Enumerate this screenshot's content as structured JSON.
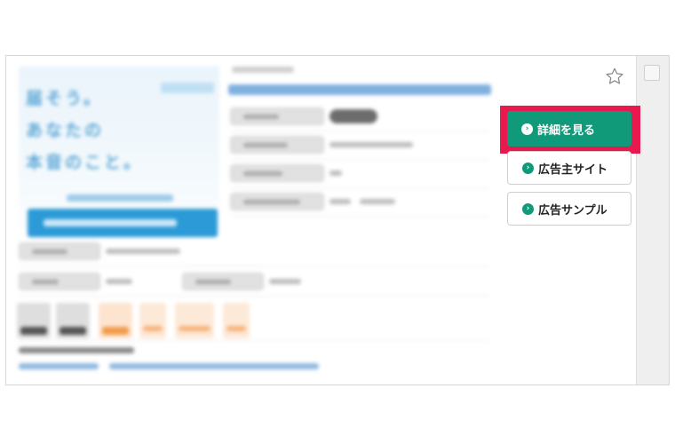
{
  "banner": {
    "headline_lines": [
      "届そう。",
      "あなたの",
      "本音のこと。"
    ]
  },
  "buttons": {
    "details_label": "詳細を見る",
    "advertiser_site_label": "広告主サイト",
    "ad_sample_label": "広告サンプル",
    "chevron_glyph": "›"
  },
  "colors": {
    "primary_green": "#119a7a",
    "highlight_red": "#e8194e",
    "link_blue": "#2b9ad6"
  },
  "icons": {
    "favorite": "star-icon",
    "chevron": "chevron-right-icon"
  }
}
